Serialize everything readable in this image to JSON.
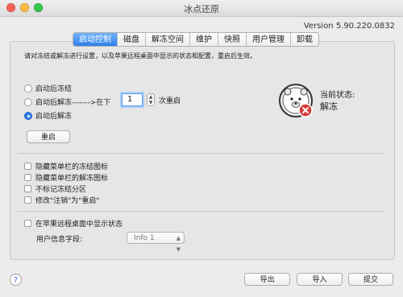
{
  "window": {
    "title": "冰点还原"
  },
  "version": "Version 5.90.220.0832",
  "tabs": [
    {
      "label": "启动控制",
      "active": true
    },
    {
      "label": "磁盘",
      "active": false
    },
    {
      "label": "解冻空间",
      "active": false
    },
    {
      "label": "维护",
      "active": false
    },
    {
      "label": "快照",
      "active": false
    },
    {
      "label": "用户管理",
      "active": false
    },
    {
      "label": "卸载",
      "active": false
    }
  ],
  "boot_control": {
    "description": "请对冻结或解冻进行设置，以及苹果远程桌面中显示的状态和配置，重启后生效。",
    "options": {
      "freeze": "启动后冻结",
      "thaw_n_prefix": "启动后解冻------->在下",
      "thaw": "启动后解冻"
    },
    "selected_option": "thaw",
    "restart_count": "1",
    "restart_suffix": "次重启",
    "restart_button": "重启",
    "status_title": "当前状态:",
    "status_value": "解冻"
  },
  "checkboxes": {
    "hide_frozen_icon": "隐藏菜单栏的冻结图标",
    "hide_thawed_icon": "隐藏菜单栏的解冻图标",
    "no_mark_partition": "不标记冻结分区",
    "rename_logout": "修改\"注销\"为\"重启\"",
    "show_in_ard": "在苹果远程桌面中显示状态"
  },
  "user_info": {
    "label": "用户信息字段:",
    "value": "Info 1"
  },
  "footer": {
    "help": "?",
    "export": "导出",
    "import": "导入",
    "submit": "提交"
  },
  "icons": {
    "status": "frozen-bear-status-icon",
    "error_badge": "close-icon"
  },
  "colors": {
    "accent": "#2e7fe9",
    "error": "#d93a36"
  }
}
